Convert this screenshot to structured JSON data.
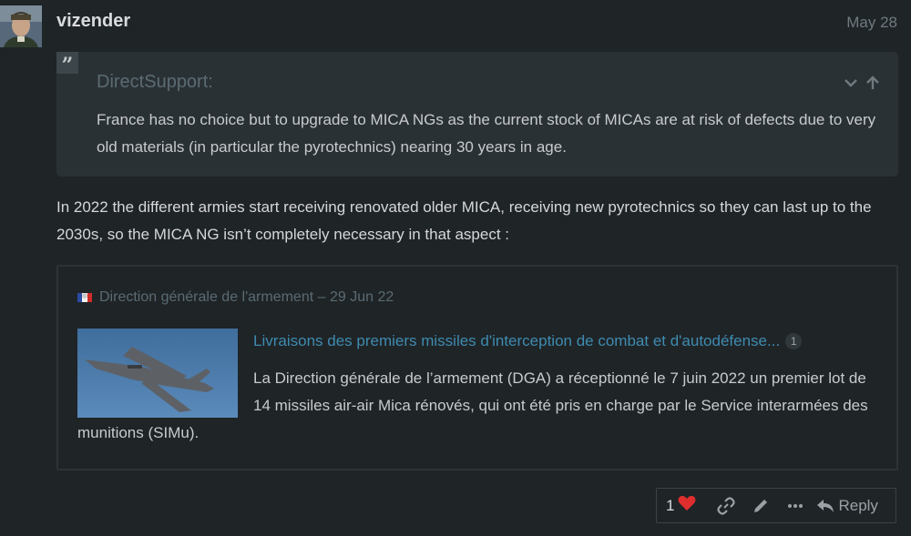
{
  "post": {
    "username": "vizender",
    "date": "May 28",
    "avatar_icon": "user-avatar"
  },
  "quote": {
    "author": "DirectSupport:",
    "text": "France has no choice but to upgrade to MICA NGs as the current stock of MICAs are at risk of defects due to very old materials (in particular the pyrotechnics) nearing 30 years in age."
  },
  "body": {
    "text": "In 2022 the different armies start receiving renovated older MICA, receiving new pyrotechnics so they can last up to the 2030s, so the MICA NG isn’t completely necessary in that aspect :"
  },
  "onebox": {
    "source": "Direction générale de l'armement – 29 Jun 22",
    "title": "Livraisons des premiers missiles d'interception de combat et d'autodéfense...",
    "click_count": "1",
    "excerpt": "La Direction générale de l’armement (DGA) a réceptionné le 7 juin 2022 un premier lot de 14 missiles air-air Mica rénovés, qui ont été pris en charge par le Service interarmées des munitions (SIMu)."
  },
  "actions": {
    "like_count": "1",
    "reply_label": "Reply"
  },
  "colors": {
    "background": "#1f2427",
    "quote_bg": "#2a3135",
    "link": "#3e8bb0",
    "heart": "#e02e2e",
    "muted": "#5a6b73"
  }
}
